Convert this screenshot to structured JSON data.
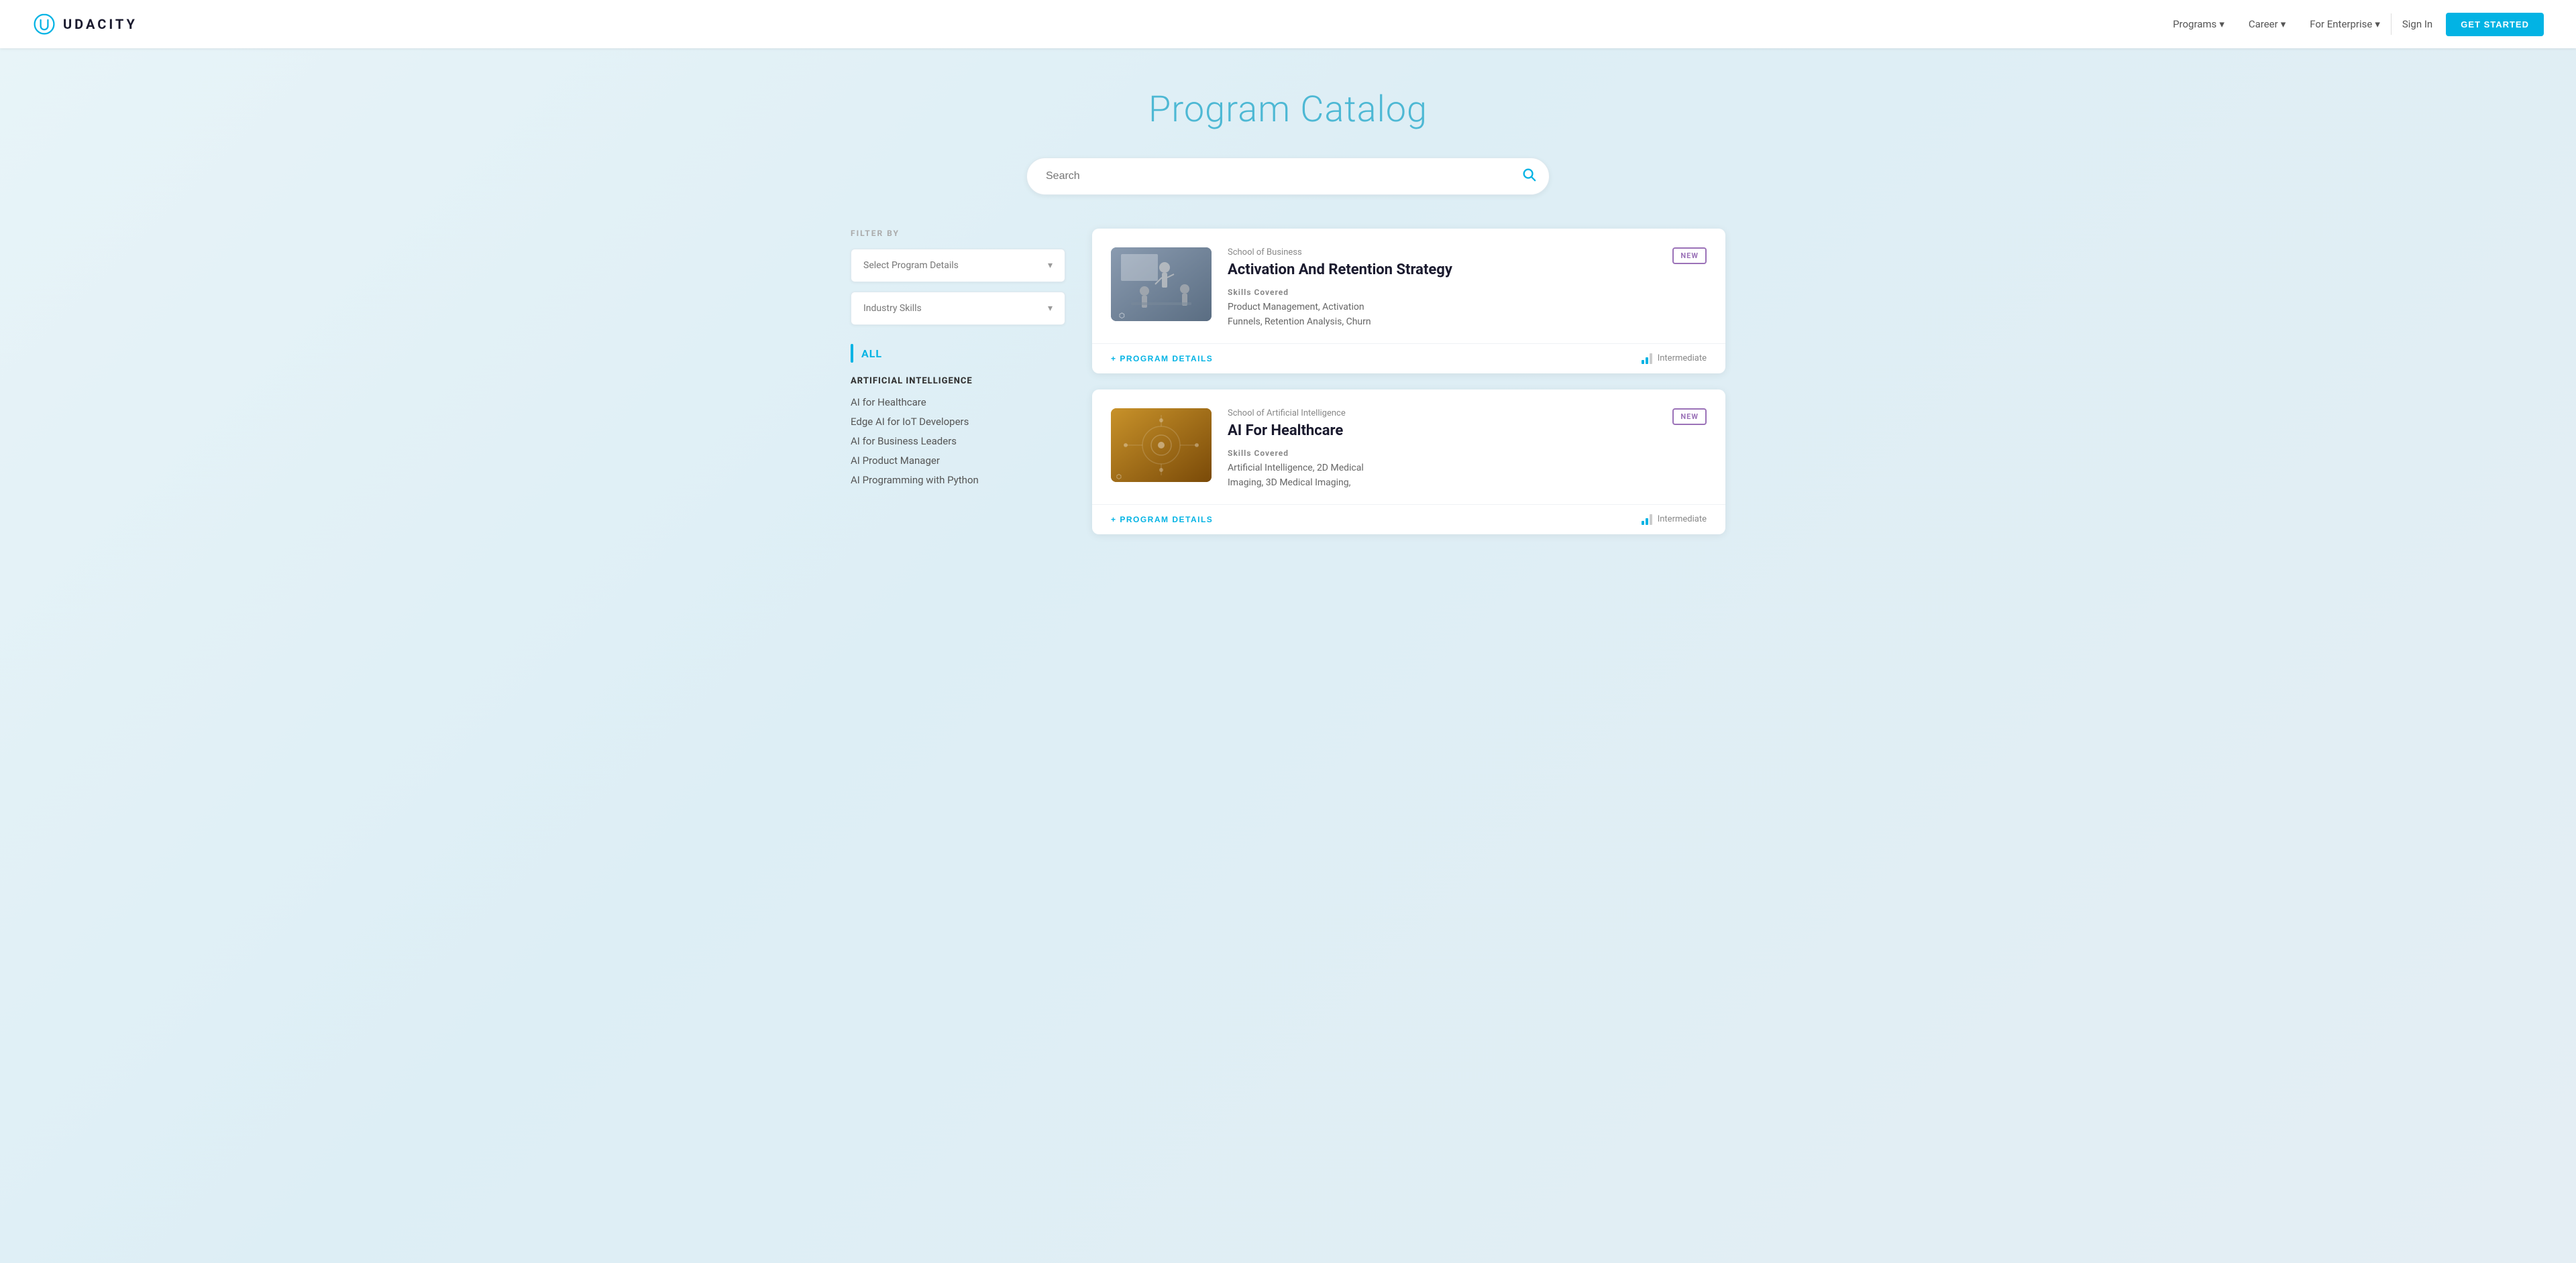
{
  "navbar": {
    "logo_text": "UDACITY",
    "nav_items": [
      {
        "label": "Programs",
        "has_dropdown": true
      },
      {
        "label": "Career",
        "has_dropdown": true
      },
      {
        "label": "For Enterprise",
        "has_dropdown": true
      }
    ],
    "signin_label": "Sign In",
    "get_started_label": "GET STARTED"
  },
  "page": {
    "title": "Program Catalog",
    "search_placeholder": "Search"
  },
  "filters": {
    "label": "FILTER BY",
    "program_details": {
      "label": "Select Program Details",
      "options": []
    },
    "industry_skills": {
      "label": "Industry Skills",
      "options": []
    }
  },
  "sidebar": {
    "all_label": "ALL",
    "categories": [
      {
        "title": "ARTIFICIAL INTELLIGENCE",
        "items": [
          "AI for Healthcare",
          "Edge AI for IoT Developers",
          "AI for Business Leaders",
          "AI Product Manager",
          "AI Programming with Python"
        ]
      }
    ]
  },
  "catalog": {
    "cards": [
      {
        "id": "card-1",
        "school": "School of Business",
        "title": "Activation And Retention Strategy",
        "badge": "NEW",
        "skills_label": "Skills Covered",
        "skills": "Product Management, Activation Funnels, Retention Analysis, Churn",
        "level": "Intermediate",
        "program_details_btn": "+ PROGRAM DETAILS",
        "thumbnail_type": "business"
      },
      {
        "id": "card-2",
        "school": "School of Artificial Intelligence",
        "title": "AI For Healthcare",
        "badge": "NEW",
        "skills_label": "Skills Covered",
        "skills": "Artificial Intelligence, 2D Medical Imaging, 3D Medical Imaging,",
        "level": "Intermediate",
        "program_details_btn": "+ PROGRAM DETAILS",
        "thumbnail_type": "ai"
      }
    ]
  }
}
